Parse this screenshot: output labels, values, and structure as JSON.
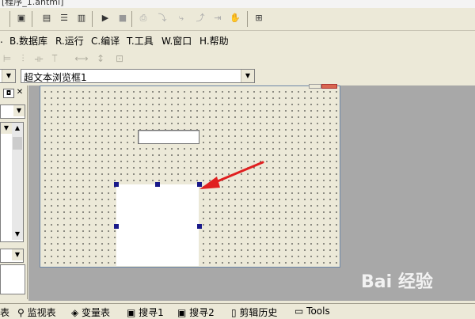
{
  "title_bar": {
    "text": "[程序_1.ahtml]"
  },
  "menu": [
    "B.数据库",
    "R.运行",
    "C.编译",
    "T.工具",
    "W.窗口",
    "H.帮助"
  ],
  "combo": {
    "selected": "超文本浏览框1"
  },
  "bottom_tabs": [
    "监视表",
    "变量表",
    "搜寻1",
    "搜寻2",
    "剪辑历史",
    "Tools"
  ],
  "watermark": {
    "text": "Bai 经验"
  },
  "colors": {
    "arrow": "#e02020",
    "handle": "#1a1a8a",
    "mdi_bg": "#a8a8a8",
    "chrome": "#ece9d8"
  }
}
